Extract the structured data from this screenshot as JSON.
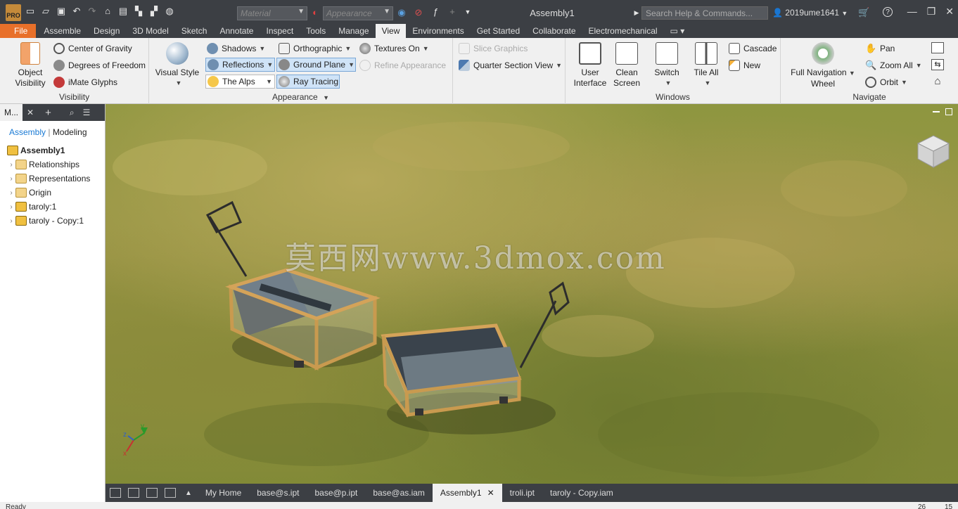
{
  "titlebar": {
    "title": "Assembly1",
    "material_placeholder": "Material",
    "appearance_placeholder": "Appearance",
    "search_placeholder": "Search Help & Commands...",
    "user": "2019ume1641"
  },
  "tabs": [
    "File",
    "Assemble",
    "Design",
    "3D Model",
    "Sketch",
    "Annotate",
    "Inspect",
    "Tools",
    "Manage",
    "View",
    "Environments",
    "Get Started",
    "Collaborate",
    "Electromechanical"
  ],
  "ribbon": {
    "visibility": {
      "title": "Visibility",
      "object_visibility_1": "Object",
      "object_visibility_2": "Visibility",
      "center_of_gravity": "Center of Gravity",
      "degrees_of_freedom": "Degrees of Freedom",
      "imate_glyphs": "iMate Glyphs"
    },
    "appearance": {
      "title": "Appearance",
      "visual_style": "Visual Style",
      "shadows": "Shadows",
      "reflections": "Reflections",
      "the_alps": "The Alps",
      "orthographic": "Orthographic",
      "ground_plane": "Ground Plane",
      "ray_tracing": "Ray Tracing",
      "textures_on": "Textures On",
      "refine_appearance": "Refine Appearance",
      "slice_graphics": "Slice Graphics",
      "quarter_section_view": "Quarter Section View"
    },
    "windows": {
      "title": "Windows",
      "user_interface_1": "User",
      "user_interface_2": "Interface",
      "clean_screen_1": "Clean",
      "clean_screen_2": "Screen",
      "switch": "Switch",
      "tile_all": "Tile All",
      "cascade": "Cascade",
      "new": "New"
    },
    "navigate": {
      "title": "Navigate",
      "full_nav_wheel_1": "Full Navigation",
      "full_nav_wheel_2": "Wheel",
      "pan": "Pan",
      "zoom_all": "Zoom All",
      "orbit": "Orbit"
    }
  },
  "browser": {
    "header": "M...",
    "mode_assembly": "Assembly",
    "mode_modeling": "Modeling",
    "root": "Assembly1",
    "items": [
      "Relationships",
      "Representations",
      "Origin",
      "taroly:1",
      "taroly - Copy:1"
    ]
  },
  "viewport": {
    "watermark": "莫西网www.3dmox.com",
    "triad_x": "x",
    "triad_y": "y",
    "triad_z": "z"
  },
  "doctabs": [
    "My Home",
    "base@s.ipt",
    "base@p.ipt",
    "base@as.iam",
    "Assembly1",
    "troli.ipt",
    "taroly - Copy.iam"
  ],
  "status": {
    "text": "Ready",
    "count1": "26",
    "count2": "15"
  }
}
